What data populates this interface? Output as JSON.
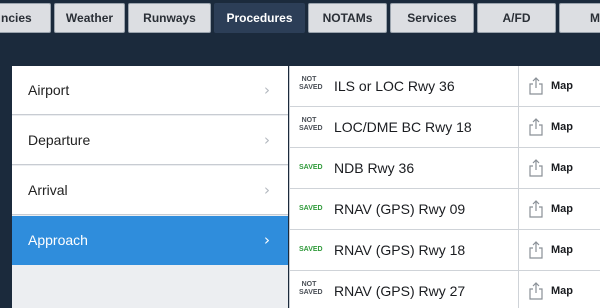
{
  "tabs": [
    {
      "label": "ncies",
      "active": false
    },
    {
      "label": "Weather",
      "active": false
    },
    {
      "label": "Runways",
      "active": false
    },
    {
      "label": "Procedures",
      "active": true
    },
    {
      "label": "NOTAMs",
      "active": false
    },
    {
      "label": "Services",
      "active": false
    },
    {
      "label": "A/FD",
      "active": false
    },
    {
      "label": "M",
      "active": false
    }
  ],
  "categories": [
    {
      "label": "Airport",
      "chevron": "›"
    },
    {
      "label": "Departure",
      "chevron": "›"
    },
    {
      "label": "Arrival",
      "chevron": "›"
    },
    {
      "label": "Approach",
      "chevron": "›",
      "selected": true
    }
  ],
  "procedures": [
    {
      "status_top": "NOT",
      "status_bottom": "SAVED",
      "saved": false,
      "name": "ILS or LOC Rwy 36",
      "map_label": "Map"
    },
    {
      "status_top": "NOT",
      "status_bottom": "SAVED",
      "saved": false,
      "name": "LOC/DME BC Rwy 18",
      "map_label": "Map"
    },
    {
      "status_top": "",
      "status_bottom": "SAVED",
      "saved": true,
      "name": "NDB Rwy 36",
      "map_label": "Map"
    },
    {
      "status_top": "",
      "status_bottom": "SAVED",
      "saved": true,
      "name": "RNAV (GPS) Rwy 09",
      "map_label": "Map"
    },
    {
      "status_top": "",
      "status_bottom": "SAVED",
      "saved": true,
      "name": "RNAV (GPS) Rwy 18",
      "map_label": "Map"
    },
    {
      "status_top": "NOT",
      "status_bottom": "SAVED",
      "saved": false,
      "name": "RNAV (GPS) Rwy 27",
      "map_label": "Map"
    }
  ],
  "colors": {
    "background": "#1b2a3c",
    "active_tab": "#2c3e57",
    "selected_item": "#2f8ddc",
    "saved_badge": "#2f9a3a"
  },
  "icons": {
    "share": "share-icon",
    "chevron": "chevron-right-icon"
  }
}
